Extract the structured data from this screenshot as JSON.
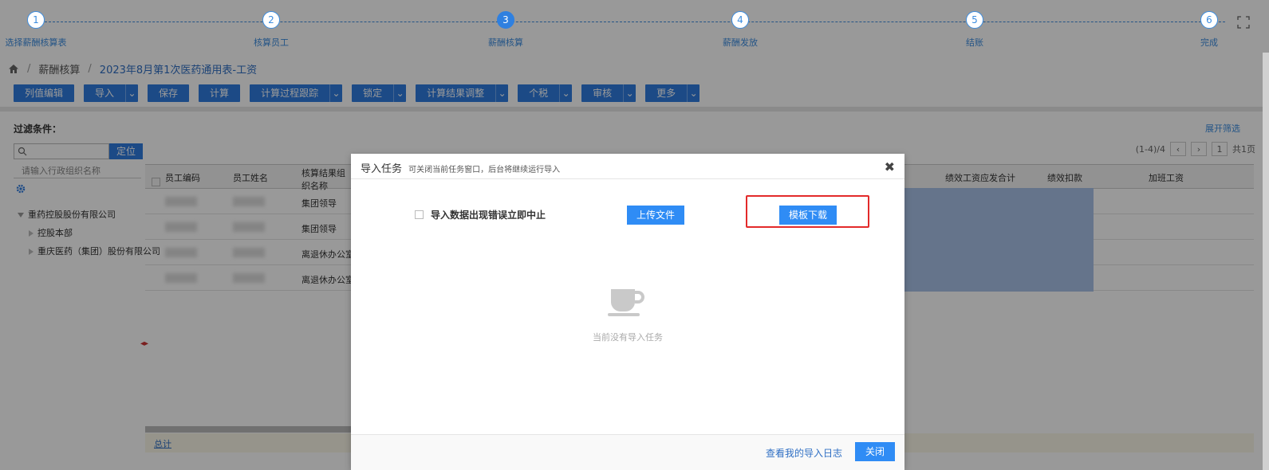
{
  "stepper": {
    "steps": [
      {
        "num": "1",
        "label": "选择薪酬核算表"
      },
      {
        "num": "2",
        "label": "核算员工"
      },
      {
        "num": "3",
        "label": "薪酬核算"
      },
      {
        "num": "4",
        "label": "薪酬发放"
      },
      {
        "num": "5",
        "label": "结账"
      },
      {
        "num": "6",
        "label": "完成"
      }
    ],
    "active_index": 3
  },
  "breadcrumb": {
    "item1": "薪酬核算",
    "item2": "2023年8月第1次医药通用表-工资"
  },
  "toolbar": {
    "col_edit": "列值编辑",
    "import": "导入",
    "save": "保存",
    "calculate": "计算",
    "trace": "计算过程跟踪",
    "lock": "锁定",
    "adjust": "计算结果调整",
    "tax": "个税",
    "review": "审核",
    "more": "更多"
  },
  "filter": {
    "title": "过滤条件：",
    "expand": "展开筛选",
    "locate": "定位",
    "org_placeholder": "请输入行政组织名称"
  },
  "tree": {
    "root": "重药控股股份有限公司",
    "child1": "控股本部",
    "child2": "重庆医药（集团）股份有限公司"
  },
  "grid": {
    "headers": {
      "emp_code": "员工编码",
      "emp_name": "员工姓名",
      "org": "核算结果组织名称",
      "perf_total": "绩效工资应发合计",
      "perf_deduct": "绩效扣款",
      "overtime": "加班工资"
    },
    "rows": [
      {
        "org": "集团领导"
      },
      {
        "org": "集团领导"
      },
      {
        "org": "离退休办公室"
      },
      {
        "org": "离退休办公室"
      }
    ],
    "total": "总计",
    "pager": {
      "range": "(1-4)/4",
      "page": "1",
      "total_pages": "共1页"
    }
  },
  "modal": {
    "title": "导入任务",
    "subtitle": "可关闭当前任务窗口，后台将继续运行导入",
    "stop_on_error": "导入数据出现错误立即中止",
    "upload": "上传文件",
    "template_download": "模板下载",
    "empty": "当前没有导入任务",
    "view_log": "查看我的导入日志",
    "close": "关闭"
  },
  "colors": {
    "primary": "#2f7ce0",
    "highlight": "#e32a2a"
  }
}
